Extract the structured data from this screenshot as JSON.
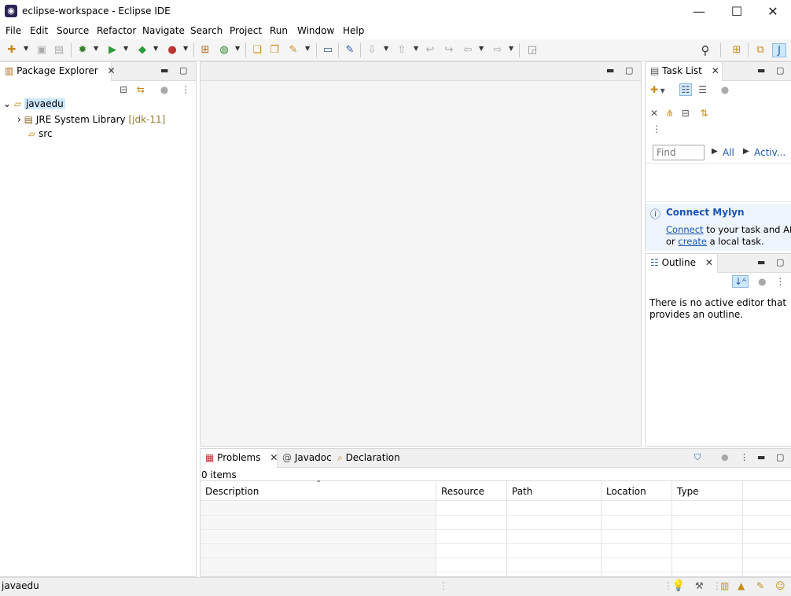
{
  "window": {
    "title": "eclipse-workspace - Eclipse IDE",
    "app_icon_glyph": "◉",
    "minimize": "—",
    "maximize": "☐",
    "close": "✕"
  },
  "menu": [
    "File",
    "Edit",
    "Source",
    "Refactor",
    "Navigate",
    "Search",
    "Project",
    "Run",
    "Window",
    "Help"
  ],
  "package_explorer": {
    "tab_label": "Package Explorer",
    "tree": {
      "project": "javaedu",
      "library_label": "JRE System Library",
      "library_version": "[jdk-11]",
      "src": "src"
    }
  },
  "task_list": {
    "tab_label": "Task List",
    "find_placeholder": "Find",
    "filter_all": "All",
    "filter_activate": "Activ...",
    "connect_title": "Connect Mylyn",
    "connect_link": "Connect",
    "connect_text": " to your task and ALM tools",
    "create_prefix": "or ",
    "create_link": "create",
    "create_text": " a local task."
  },
  "outline": {
    "tab_label": "Outline",
    "message_line1": "There is no active editor that",
    "message_line2": "provides an outline."
  },
  "problems": {
    "tabs": [
      "Problems",
      "Javadoc",
      "Declaration"
    ],
    "count": "0 items",
    "columns": [
      "Description",
      "Resource",
      "Path",
      "Location",
      "Type"
    ]
  },
  "status": {
    "selection": "javaedu"
  },
  "colors": {
    "accent": "#1a56b3",
    "selection_bg": "#cde8ff",
    "tab_bg": "#f0f0f0"
  }
}
